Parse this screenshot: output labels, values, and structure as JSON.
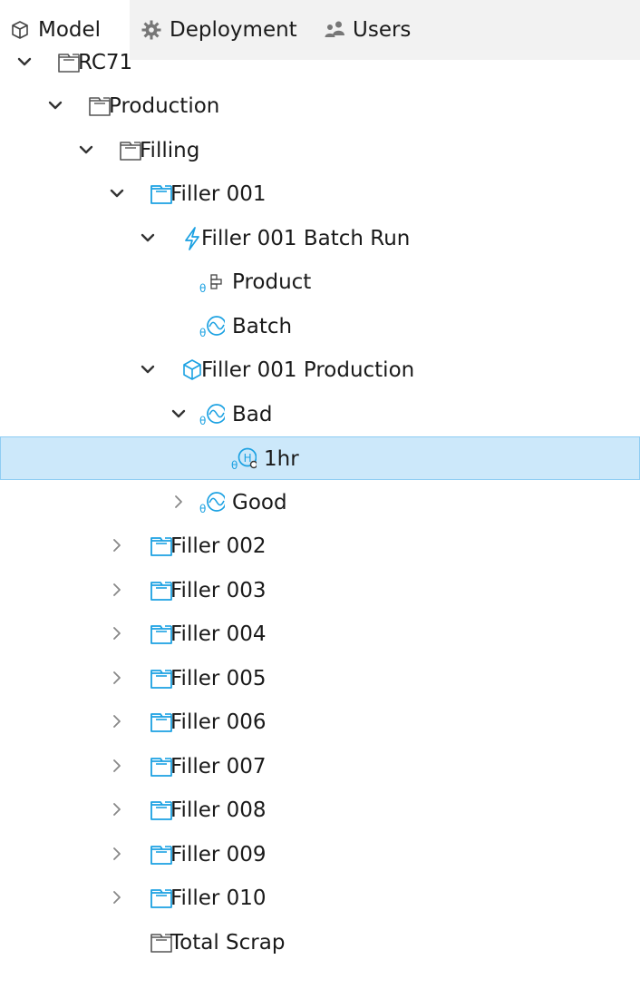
{
  "tabs": [
    {
      "label": "Model",
      "icon": "cube-icon"
    },
    {
      "label": "Deployment",
      "icon": "gear-icon"
    },
    {
      "label": "Users",
      "icon": "users-icon"
    }
  ],
  "tree": {
    "selected": "1hr",
    "nodes": [
      {
        "label": "RC71",
        "icon": "folder-icon",
        "state": "expanded"
      },
      {
        "label": "Production",
        "icon": "folder-icon",
        "state": "expanded"
      },
      {
        "label": "Filling",
        "icon": "folder-icon",
        "state": "expanded"
      },
      {
        "label": "Filler 001",
        "icon": "folder-blue-icon",
        "state": "expanded"
      },
      {
        "label": "Filler 001 Batch Run",
        "icon": "lightning-icon",
        "state": "expanded"
      },
      {
        "label": "Product",
        "icon": "attribute-list-icon",
        "state": "leaf"
      },
      {
        "label": "Batch",
        "icon": "attribute-signal-icon",
        "state": "leaf"
      },
      {
        "label": "Filler 001 Production",
        "icon": "cube-blue-icon",
        "state": "expanded"
      },
      {
        "label": "Bad",
        "icon": "attribute-signal-icon",
        "state": "expanded"
      },
      {
        "label": "1hr",
        "icon": "attribute-history-icon",
        "state": "leaf"
      },
      {
        "label": "Good",
        "icon": "attribute-signal-icon",
        "state": "collapsed"
      },
      {
        "label": "Filler 002",
        "icon": "folder-blue-icon",
        "state": "collapsed"
      },
      {
        "label": "Filler 003",
        "icon": "folder-blue-icon",
        "state": "collapsed"
      },
      {
        "label": "Filler 004",
        "icon": "folder-blue-icon",
        "state": "collapsed"
      },
      {
        "label": "Filler 005",
        "icon": "folder-blue-icon",
        "state": "collapsed"
      },
      {
        "label": "Filler 006",
        "icon": "folder-blue-icon",
        "state": "collapsed"
      },
      {
        "label": "Filler 007",
        "icon": "folder-blue-icon",
        "state": "collapsed"
      },
      {
        "label": "Filler 008",
        "icon": "folder-blue-icon",
        "state": "collapsed"
      },
      {
        "label": "Filler 009",
        "icon": "folder-blue-icon",
        "state": "collapsed"
      },
      {
        "label": "Filler 010",
        "icon": "folder-blue-icon",
        "state": "collapsed"
      },
      {
        "label": "Total Scrap",
        "icon": "folder-icon",
        "state": "leaf"
      }
    ]
  },
  "colors": {
    "accent": "#1ba1e2",
    "selection": "#cce8fa",
    "selection_border": "#8fcdf3",
    "tabbar": "#f2f2f2"
  }
}
